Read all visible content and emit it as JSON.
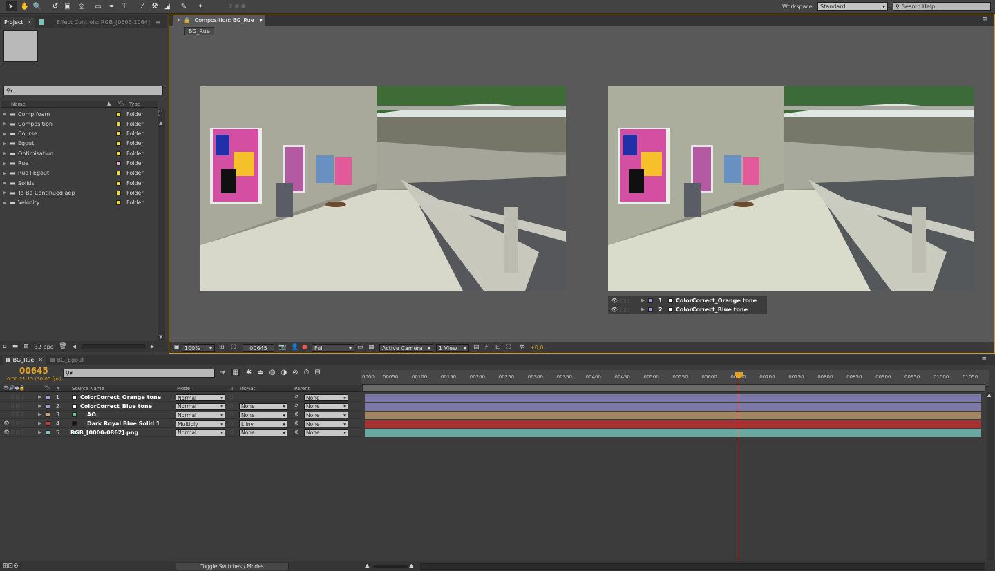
{
  "toolbar": {
    "tools": [
      "selection-tool",
      "hand-tool",
      "zoom-tool",
      "rotation-tool",
      "camera-tool",
      "pan-behind-tool",
      "rectangle-tool",
      "pen-tool",
      "type-tool",
      "brush-tool",
      "clone-stamp-tool",
      "eraser-tool",
      "roto-brush-tool",
      "puppet-tool"
    ],
    "workspace_label": "Workspace:",
    "workspace_value": "Standard",
    "search_placeholder": "Search Help"
  },
  "project_panel": {
    "tab_project": "Project",
    "tab_effect_controls": "Effect Controls: RGB_[0605-1064]",
    "search_placeholder": "",
    "col_name": "Name",
    "col_type": "Type",
    "items": [
      {
        "name": "Comp foam",
        "type": "Folder",
        "color": "#e8d84a"
      },
      {
        "name": "Composition",
        "type": "Folder",
        "color": "#e8d84a"
      },
      {
        "name": "Course",
        "type": "Folder",
        "color": "#e8d84a"
      },
      {
        "name": "Egout",
        "type": "Folder",
        "color": "#e8d84a"
      },
      {
        "name": "Optimisation",
        "type": "Folder",
        "color": "#e8d84a"
      },
      {
        "name": "Rue",
        "type": "Folder",
        "color": "#e0b3d6"
      },
      {
        "name": "Rue+Egout",
        "type": "Folder",
        "color": "#e8d84a"
      },
      {
        "name": "Solids",
        "type": "Folder",
        "color": "#e8d84a"
      },
      {
        "name": "To Be Continued.aep",
        "type": "Folder",
        "color": "#e8d84a"
      },
      {
        "name": "Velocity",
        "type": "Folder",
        "color": "#e8d84a"
      }
    ],
    "bpc": "32 bpc"
  },
  "composition_panel": {
    "tab_label": "Composition: BG_Rue",
    "breadcrumb": "BG_Rue",
    "overlay_layers": [
      {
        "num": "1",
        "name": "ColorCorrect_Orange tone"
      },
      {
        "num": "2",
        "name": "ColorCorrect_Blue tone"
      }
    ],
    "zoom": "100%",
    "timecode": "00645",
    "resolution": "Full",
    "camera": "Active Camera",
    "views": "1 View",
    "exposure": "+0,0"
  },
  "timeline": {
    "tab_active": "BG_Rue",
    "tab_inactive": "BG_Egout",
    "current_frame": "00645",
    "current_time": "0:00:21:15 (30.00 fps)",
    "search_placeholder": "",
    "col_num": "#",
    "col_source": "Source Name",
    "col_mode": "Mode",
    "col_t": "T",
    "col_trkmat": "TrkMat",
    "col_parent": "Parent",
    "layers": [
      {
        "num": "1",
        "name": "ColorCorrect_Orange tone",
        "mode": "Normal",
        "trkmat": "",
        "parent": "None",
        "label": "#9b9bd6",
        "bar": "#7c78a8",
        "eye": false
      },
      {
        "num": "2",
        "name": "ColorCorrect_Blue tone",
        "mode": "Normal",
        "trkmat": "None",
        "parent": "None",
        "label": "#9b9bd6",
        "bar": "#7c78a8",
        "eye": false
      },
      {
        "num": "3",
        "name": "AO",
        "mode": "Normal",
        "trkmat": "None",
        "parent": "None",
        "label": "#c6a77a",
        "bar": "#a08662",
        "eye": false
      },
      {
        "num": "4",
        "name": "Dark Royal Blue Solid 1",
        "mode": "Multiply",
        "trkmat": "L.Inv",
        "parent": "None",
        "label": "#c43838",
        "bar": "#a83232",
        "eye": true
      },
      {
        "num": "5",
        "name": "RGB_[0000-0862].png",
        "mode": "Normal",
        "trkmat": "None",
        "parent": "None",
        "label": "#7ec4bc",
        "bar": "#6aa9a0",
        "eye": true
      }
    ],
    "ruler_ticks": [
      "0000",
      "00050",
      "00100",
      "00150",
      "00200",
      "00250",
      "00300",
      "00350",
      "00400",
      "00450",
      "00500",
      "00550",
      "00600",
      "00650",
      "00700",
      "00750",
      "00800",
      "00850",
      "00900",
      "00950",
      "01000",
      "01050"
    ],
    "toggle_label": "Toggle Switches / Modes"
  }
}
